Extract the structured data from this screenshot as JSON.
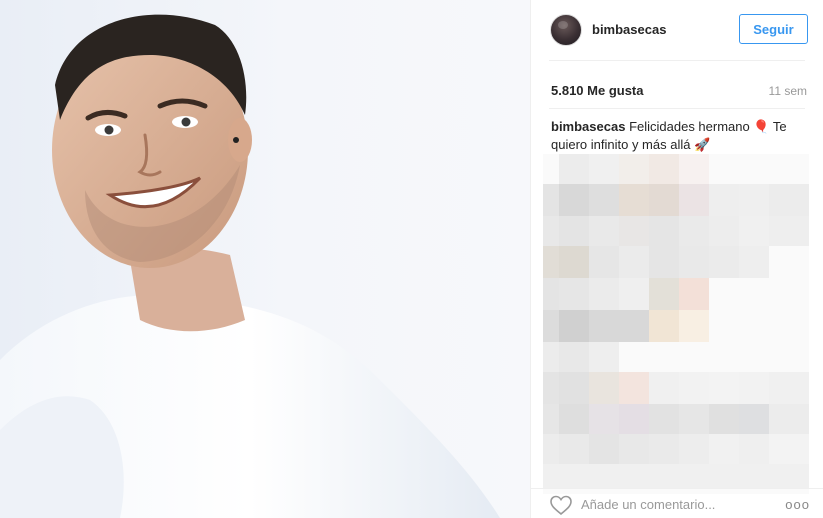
{
  "post": {
    "username": "bimbasecas",
    "follow_label": "Seguir",
    "likes_text": "5.810 Me gusta",
    "time_ago": "11 sem",
    "caption_user": "bimbasecas",
    "caption_text": "Felicidades hermano 🎈 Te quiero infinito y más allá 🚀",
    "comment_placeholder": "Añade un comentario...",
    "more_label": "ooo"
  },
  "colors": {
    "accent": "#3897f0",
    "text": "#262626",
    "muted": "#999999",
    "divider": "#efefef"
  },
  "icons": {
    "like": "heart-outline-icon",
    "more": "more-options-icon"
  }
}
